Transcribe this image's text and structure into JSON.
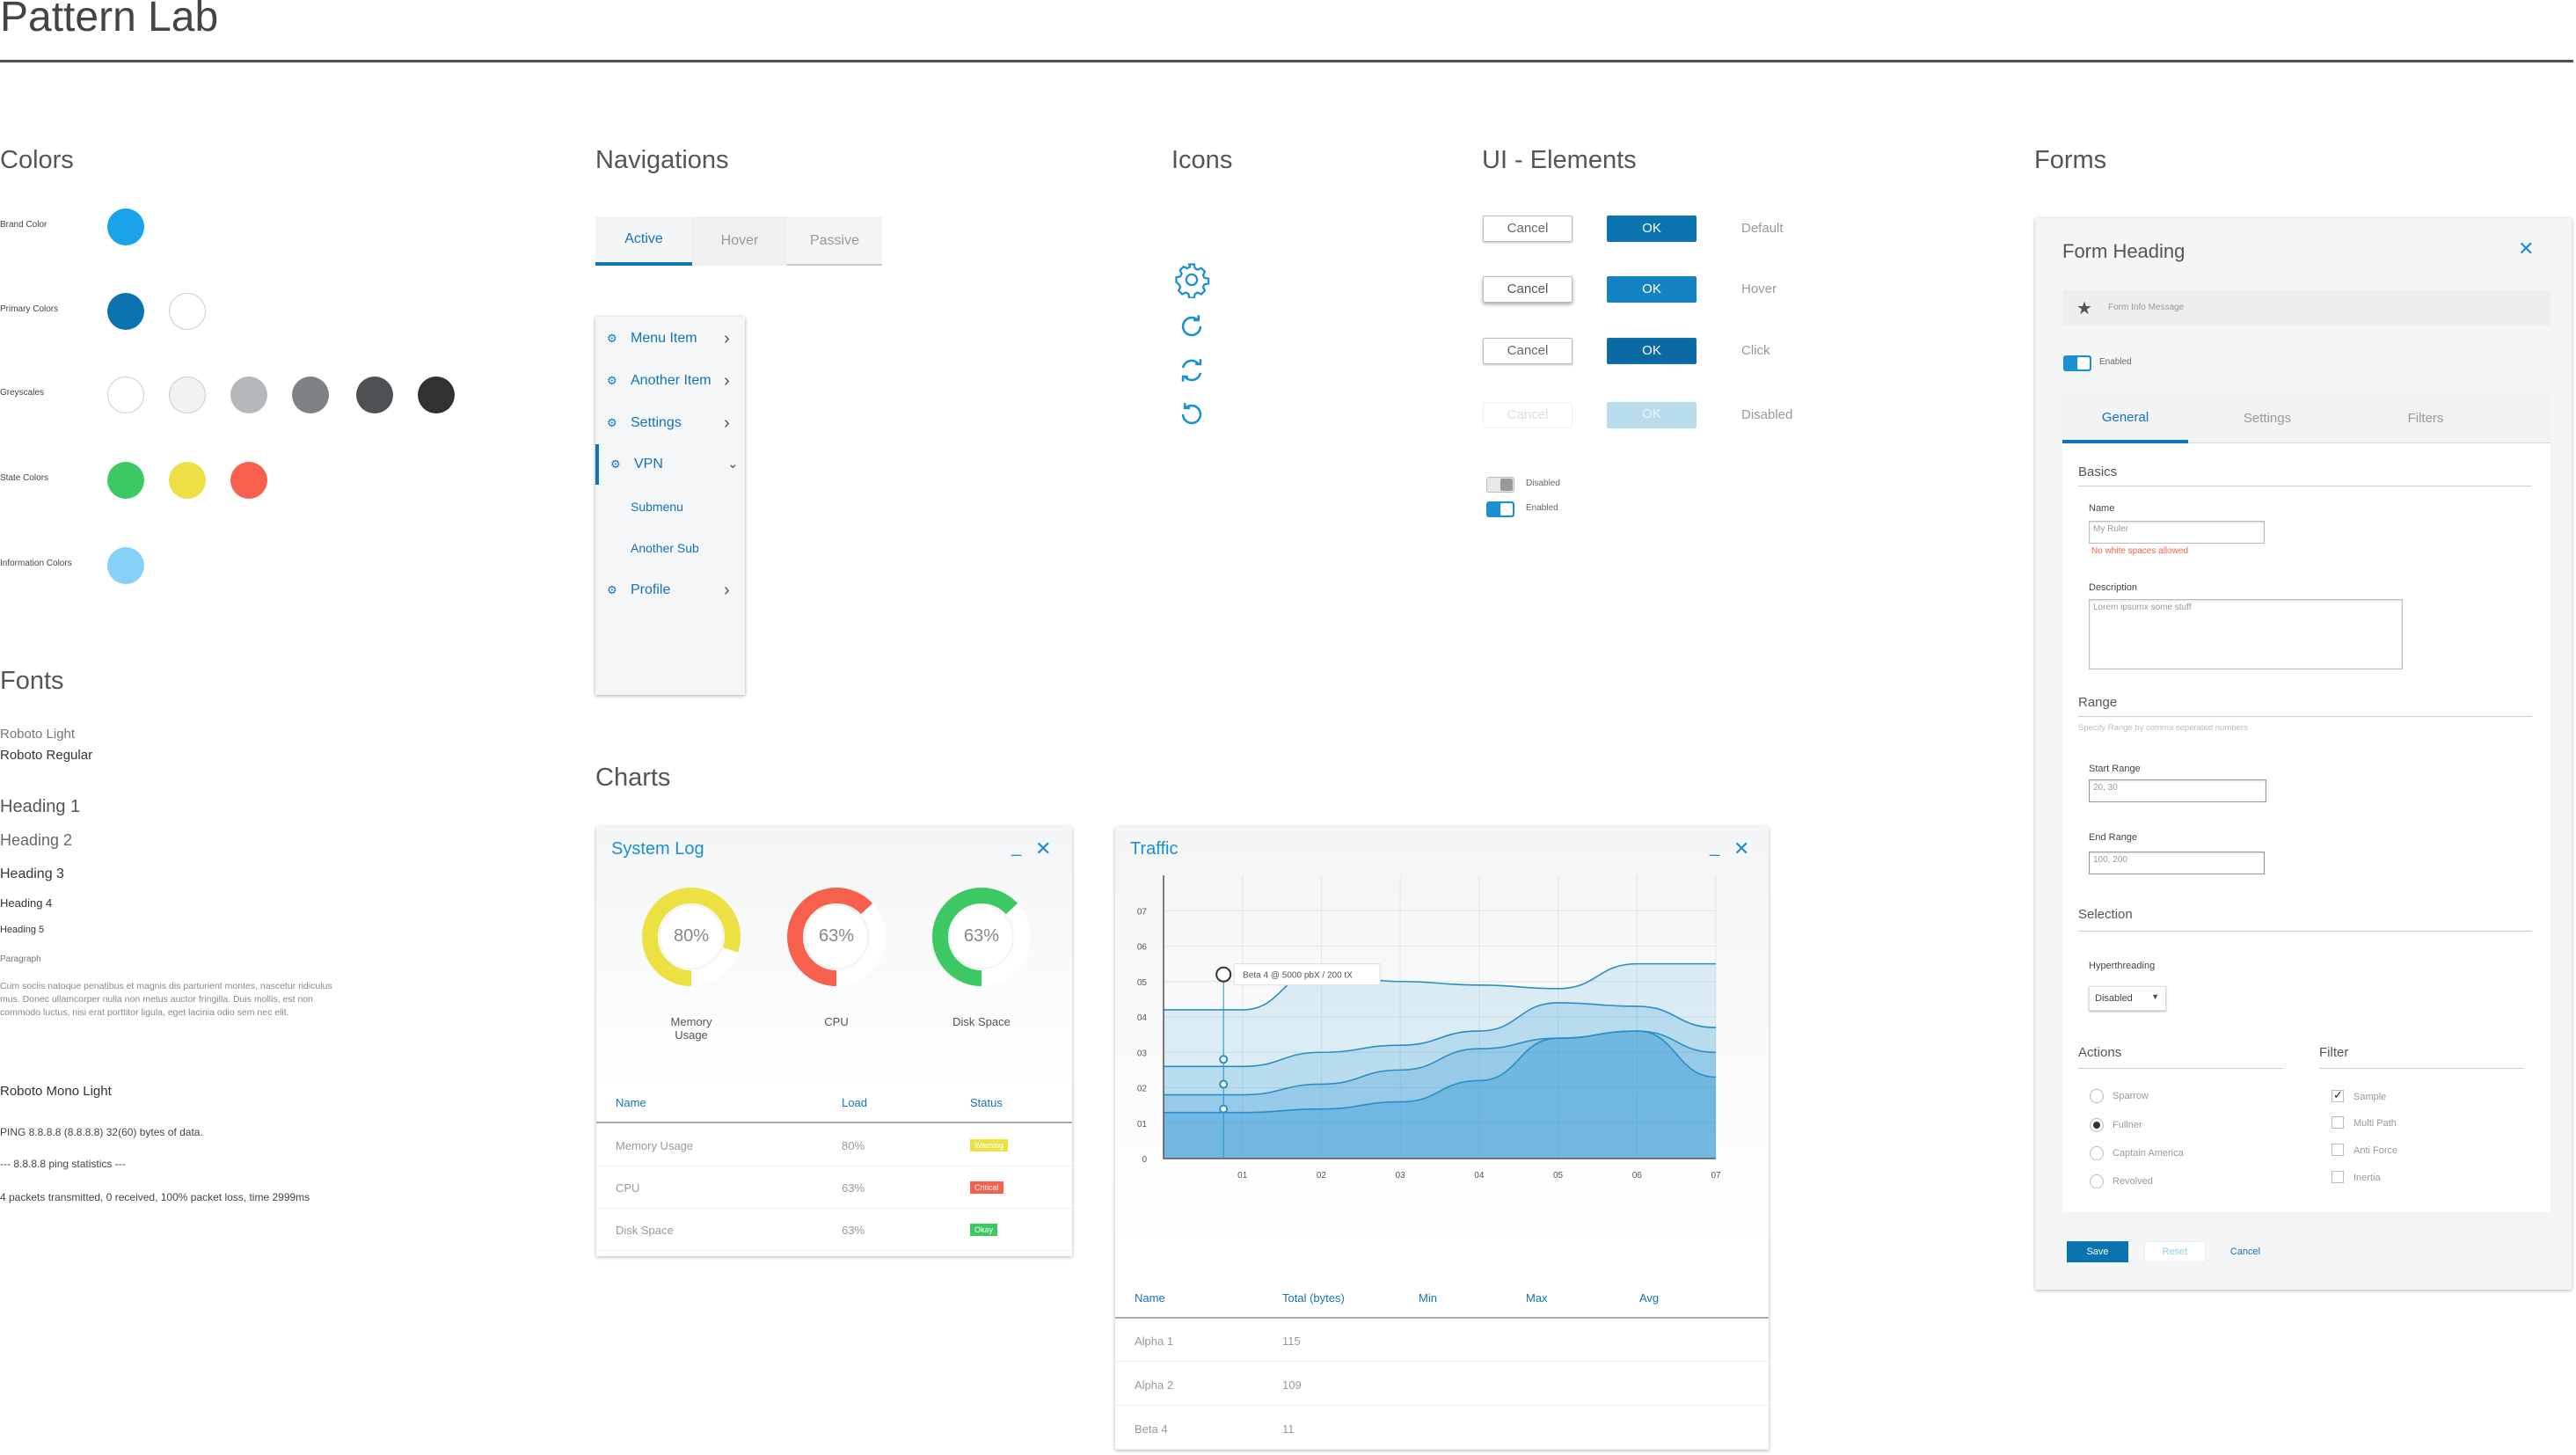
{
  "title": "Pattern Lab",
  "colors": {
    "heading": "Colors",
    "rows": [
      {
        "label": "Brand Color",
        "swatches": [
          "#1aa3e8"
        ]
      },
      {
        "label": "Primary Colors",
        "swatches": [
          "#0a73b0",
          "#ffffff"
        ]
      },
      {
        "label": "Greyscales",
        "swatches": [
          "#ffffff",
          "#f2f2f2",
          "#b5b8ba",
          "#7d8183",
          "#4d5153",
          "#2f3133"
        ]
      },
      {
        "label": "State Colors",
        "swatches": [
          "#3cc863",
          "#ede043",
          "#f8604e"
        ]
      },
      {
        "label": "Information Colors",
        "swatches": [
          "#86d1f7"
        ]
      }
    ]
  },
  "fonts": {
    "heading": "Fonts",
    "light": "Roboto Light",
    "regular": "Roboto Regular",
    "h1": "Heading 1",
    "h2": "Heading 2",
    "h3": "Heading 3",
    "h4": "Heading 4",
    "h5": "Heading 5",
    "paragraph_label": "Paragraph",
    "paragraph": "Cum sociis natoque penatibus et magnis dis parturient montes, nascetur ridiculus mus. Donec ullamcorper nulla non metus auctor fringilla. Duis mollis, est non commodo luctus, nisi erat porttitor ligula, eget lacinia odio sem nec elit.",
    "mono_heading": "Roboto Mono Light",
    "mono_line1": "PING 8.8.8.8 (8.8.8.8) 32(60) bytes of data.",
    "mono_line2": "--- 8.8.8.8 ping statistics ---",
    "mono_line3": "4 packets transmitted, 0 received, 100% packet loss, time 2999ms"
  },
  "navigations": {
    "heading": "Navigations",
    "tabs": [
      "Active",
      "Hover",
      "Passive"
    ],
    "menu": [
      "Menu Item",
      "Another Item",
      "Settings",
      "VPN",
      "Submenu",
      "Another Sub",
      "Profile"
    ]
  },
  "icons": {
    "heading": "Icons",
    "names": [
      "gear-icon",
      "refresh-icon",
      "sync-icon",
      "undo-icon"
    ]
  },
  "ui_elements": {
    "heading": "UI - Elements",
    "cancel": "Cancel",
    "ok": "OK",
    "states": [
      "Default",
      "Hover",
      "Click",
      "Disabled"
    ],
    "toggle_disabled": "Disabled",
    "toggle_enabled": "Enabled"
  },
  "charts": {
    "heading": "Charts",
    "system_log": {
      "title": "System Log",
      "gauges": [
        {
          "value": "80%",
          "label": "Memory Usage",
          "percent": 80,
          "color": "#ede043"
        },
        {
          "value": "63%",
          "label": "CPU",
          "percent": 63,
          "color": "#f8604e"
        },
        {
          "value": "63%",
          "label": "Disk Space",
          "percent": 63,
          "color": "#3cc863"
        }
      ],
      "columns": [
        "Name",
        "Load",
        "Status"
      ],
      "rows": [
        {
          "name": "Memory Usage",
          "load": "80%",
          "status": "Warning",
          "color": "#ede043"
        },
        {
          "name": "CPU",
          "load": "63%",
          "status": "Critical",
          "color": "#f8604e"
        },
        {
          "name": "Disk Space",
          "load": "63%",
          "status": "Okay",
          "color": "#3cc863"
        }
      ]
    },
    "traffic": {
      "title": "Traffic",
      "tooltip": "Beta 4 @ 5000 pbX / 200 tX",
      "columns": [
        "Name",
        "Total (bytes)",
        "Min",
        "Max",
        "Avg"
      ],
      "rows": [
        {
          "name": "Alpha 1",
          "total": "115"
        },
        {
          "name": "Alpha 2",
          "total": "109"
        },
        {
          "name": "Beta 4",
          "total": "11"
        }
      ]
    }
  },
  "chart_data": {
    "type": "area",
    "title": "Traffic",
    "x": [
      "01",
      "02",
      "03",
      "04",
      "05",
      "06",
      "07"
    ],
    "y_ticks": [
      "0",
      "01",
      "02",
      "03",
      "04",
      "05",
      "06",
      "07"
    ],
    "ylim": [
      0,
      8
    ],
    "grid": true,
    "series": [
      {
        "values": [
          4.2,
          5.3,
          5.0,
          4.9,
          4.8,
          5.5,
          5.5
        ]
      },
      {
        "values": [
          2.6,
          3.0,
          3.2,
          3.6,
          4.4,
          4.3,
          3.7
        ]
      },
      {
        "values": [
          1.8,
          2.1,
          2.5,
          3.1,
          3.4,
          3.6,
          3.0
        ]
      },
      {
        "values": [
          1.3,
          1.4,
          1.6,
          2.2,
          3.4,
          3.6,
          2.3
        ]
      }
    ]
  },
  "forms": {
    "heading": "Forms",
    "form_heading": "Form Heading",
    "info": "Form Info Message",
    "enabled": "Enabled",
    "tabs": [
      "General",
      "Settings",
      "Filters"
    ],
    "basics": "Basics",
    "name_label": "Name",
    "name_value": "My Ruler",
    "name_error": "No white spaces allowed",
    "desc_label": "Description",
    "desc_value": "Lorem ipsumx some stuff",
    "range": "Range",
    "range_hint": "Specify Range by comma seperated numbers",
    "start_label": "Start Range",
    "start_value": "20, 30",
    "end_label": "End Range",
    "end_value": "100, 200",
    "selection": "Selection",
    "hyper_label": "Hyperthreading",
    "hyper_value": "Disabled",
    "actions": "Actions",
    "filter": "Filter",
    "radios": [
      "Sparrow",
      "Fullner",
      "Captain America",
      "Revolved"
    ],
    "checks": [
      "Sample",
      "Multi Path",
      "Anti Force",
      "Inertia"
    ],
    "save": "Save",
    "reset": "Reset",
    "cancel": "Cancel"
  }
}
